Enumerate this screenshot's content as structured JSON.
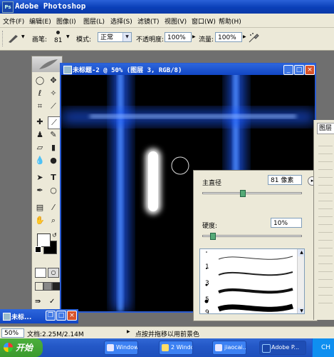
{
  "app": {
    "title": "Adobe Photoshop",
    "icon": "photoshop-icon"
  },
  "menu": [
    "文件(F)",
    "编辑(E)",
    "图像(I)",
    "图层(L)",
    "选择(S)",
    "滤镜(T)",
    "视图(V)",
    "窗口(W)",
    "帮助(H)"
  ],
  "options": {
    "brush_label": "画笔:",
    "brush_size": "81",
    "mode_label": "模式:",
    "mode_value": "正常",
    "opacity_label": "不透明度:",
    "opacity_value": "100%",
    "flow_label": "流量:",
    "flow_value": "100%"
  },
  "document": {
    "title": "未标题-2 @ 50% (图层 3, RGB/8)",
    "minimize": "_",
    "maximize": "□",
    "close": "×",
    "glow_color": "#1d5cff"
  },
  "brush_popup": {
    "diameter_label": "主直径",
    "diameter_value": "81 像素",
    "hardness_label": "硬度:",
    "hardness_value": "10%",
    "diameter_slider": 0.4,
    "hardness_slider": 0.1,
    "brush_sizes": [
      "1",
      "3",
      "5",
      "9"
    ],
    "menu_arrow": "▸"
  },
  "layers": {
    "tab": "图层"
  },
  "mini_window": {
    "title": "未标..."
  },
  "status": {
    "zoom": "50%",
    "doc_info": "文档:2.25M/2.14M",
    "hint": "点按并拖移以用前景色"
  },
  "taskbar": {
    "start": "开始",
    "tasks": [
      "Windows...",
      "2 Windo...",
      "jiaocai...",
      "Adobe P..."
    ],
    "tray": "CH"
  }
}
